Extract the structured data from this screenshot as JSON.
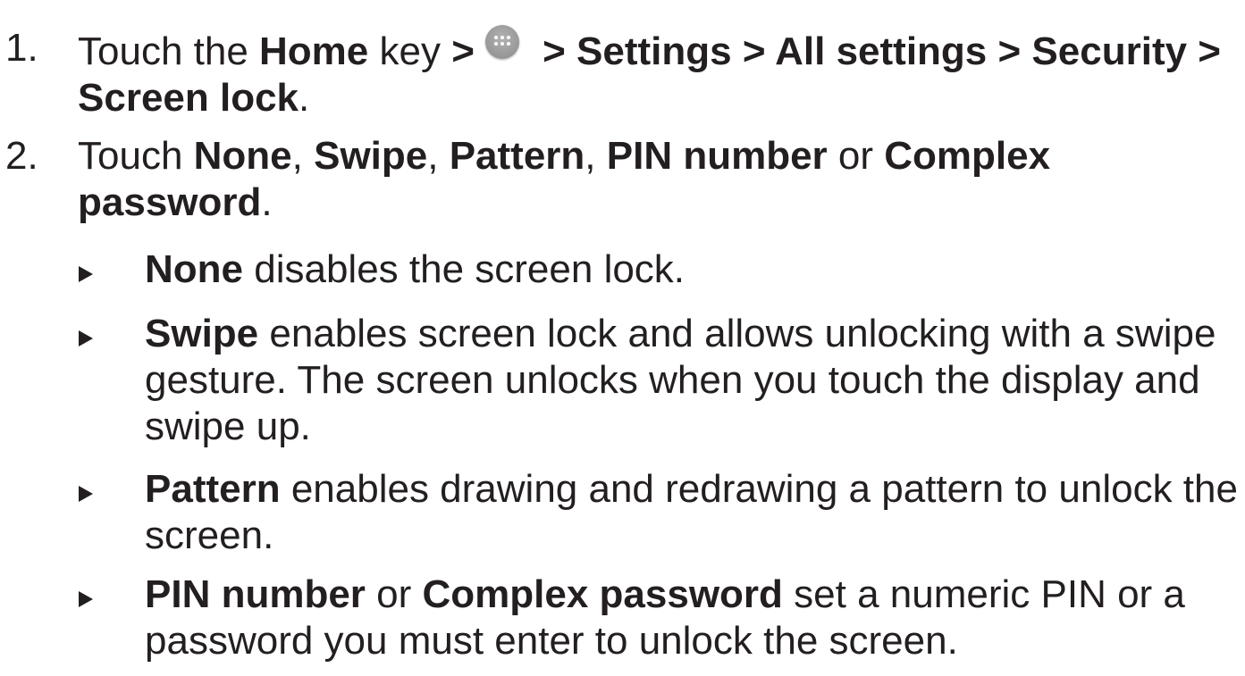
{
  "steps": [
    {
      "number": "1.",
      "pre": "Touch the ",
      "home": "Home",
      "key": " key ",
      "gt1": ">",
      "gt2": " > Settings > All settings > Security > Screen lock",
      "end": "."
    },
    {
      "number": "2.",
      "pre": "Touch ",
      "none": "None",
      "c1": ", ",
      "swipe": "Swipe",
      "c2": ", ",
      "pattern": "Pattern",
      "c3": ", ",
      "pin": "PIN number",
      "or": " or ",
      "complex": "Complex password",
      "end": "."
    }
  ],
  "bullets": [
    {
      "term": "None",
      "text": " disables the screen lock."
    },
    {
      "term": "Swipe",
      "text": " enables screen lock and allows unlocking with a swipe gesture. The screen unlocks when you touch the display and swipe up."
    },
    {
      "term": "Pattern",
      "text": " enables drawing and redrawing a pattern to unlock the screen."
    },
    {
      "term": "PIN number",
      "or": " or ",
      "term2": "Complex password",
      "text": " set a numeric PIN or a password you must enter to unlock the screen."
    }
  ],
  "icons": {
    "apps": "apps-launcher-icon"
  }
}
